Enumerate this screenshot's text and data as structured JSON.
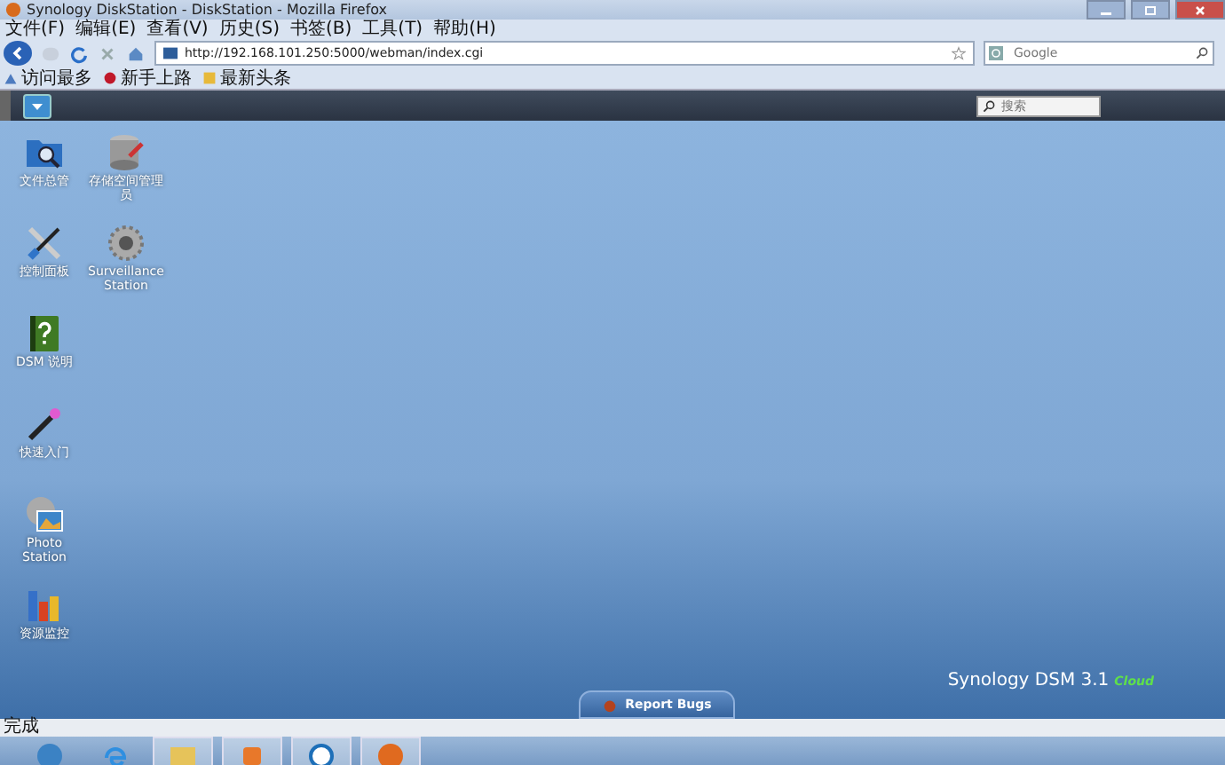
{
  "window": {
    "title": "Synology DiskStation - DiskStation - Mozilla Firefox"
  },
  "menu": [
    "文件(F)",
    "编辑(E)",
    "查看(V)",
    "历史(S)",
    "书签(B)",
    "工具(T)",
    "帮助(H)"
  ],
  "address": {
    "value": "http://192.168.101.250:5000/webman/index.cgi"
  },
  "web_search": {
    "placeholder": "Google"
  },
  "bookmarks": [
    {
      "label": "访问最多",
      "kind": "most"
    },
    {
      "label": "新手上路",
      "kind": "start"
    },
    {
      "label": "最新头条",
      "kind": "news"
    }
  ],
  "dsm_search": {
    "placeholder": "搜索"
  },
  "desktop_rows": [
    {
      "icons": [
        {
          "label": "文件总管",
          "kind": "folder"
        },
        {
          "label": "存储空间管理员",
          "kind": "storage"
        }
      ]
    },
    {
      "icons": [
        {
          "label": "控制面板",
          "kind": "tools"
        },
        {
          "label": "Surveillance Station",
          "kind": "gear"
        }
      ]
    },
    {
      "icons": [
        {
          "label": "DSM 说明",
          "kind": "help"
        }
      ]
    },
    {
      "icons": [
        {
          "label": "快速入门",
          "kind": "wand"
        }
      ]
    },
    {
      "icons": [
        {
          "label": "Photo Station",
          "kind": "photo"
        }
      ]
    },
    {
      "icons": [
        {
          "label": "资源监控",
          "kind": "chart"
        }
      ]
    }
  ],
  "report_button": "Report Bugs",
  "brand": {
    "name": "Synology DSM 3.1",
    "edition": "Cloud"
  },
  "status_bar": "完成",
  "taskbar": [
    {
      "kind": "start"
    },
    {
      "kind": "ie"
    },
    {
      "kind": "folder"
    },
    {
      "kind": "media"
    },
    {
      "kind": "app"
    },
    {
      "kind": "firefox"
    }
  ]
}
